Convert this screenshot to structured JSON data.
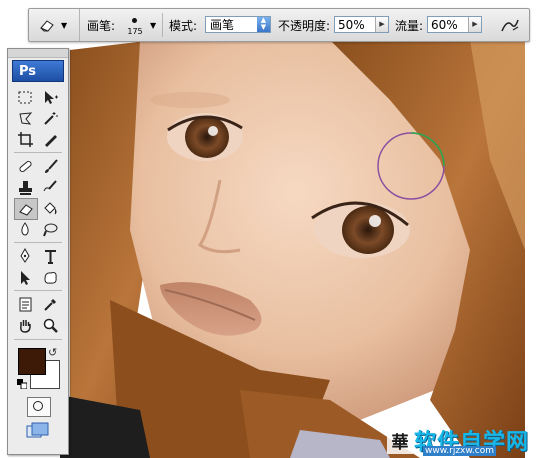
{
  "options_bar": {
    "tool_preset_icon": "eraser-icon",
    "brush_label": "画笔:",
    "brush_size": "175",
    "mode_label": "模式:",
    "mode_value": "画笔",
    "opacity_label": "不透明度:",
    "opacity_value": "50%",
    "flow_label": "流量:",
    "flow_value": "60%",
    "airbrush_icon": "airbrush-icon"
  },
  "toolbox": {
    "logo": "Ps",
    "tools": [
      "marquee-icon",
      "move-icon",
      "lasso-icon",
      "magic-wand-icon",
      "crop-icon",
      "slice-icon",
      "healing-brush-icon",
      "brush-icon",
      "clone-stamp-icon",
      "history-brush-icon",
      "eraser-icon",
      "paint-bucket-icon",
      "blur-icon",
      "dodge-icon",
      "pen-icon",
      "type-icon",
      "path-selection-icon",
      "custom-shape-icon",
      "notes-icon",
      "eyedropper-icon",
      "hand-icon",
      "zoom-icon"
    ],
    "foreground_color": "#3d1a08",
    "background_color": "#ffffff"
  },
  "watermark": {
    "text": "软件自学网",
    "url": "www.rjzxw.com",
    "logo_char": "華"
  }
}
